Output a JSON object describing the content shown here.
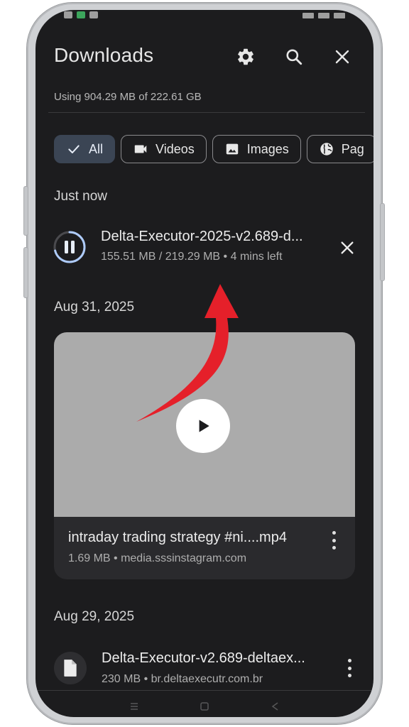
{
  "app": {
    "title": "Downloads",
    "storage_text": "Using 904.29 MB of 222.61 GB"
  },
  "toolbar": {
    "icons": [
      "gear-icon",
      "search-icon",
      "close-icon"
    ]
  },
  "filters": [
    {
      "label": "All",
      "icon": "check-icon",
      "selected": true
    },
    {
      "label": "Videos",
      "icon": "video-camera-icon",
      "selected": false
    },
    {
      "label": "Images",
      "icon": "image-icon",
      "selected": false
    },
    {
      "label": "Pag",
      "icon": "globe-icon",
      "selected": false
    }
  ],
  "sections": {
    "just_now": "Just now",
    "aug31": "Aug 31, 2025",
    "aug29": "Aug 29, 2025"
  },
  "active_download": {
    "name": "Delta-Executor-2025-v2.689-d...",
    "meta": "155.51 MB / 219.29 MB • 4 mins left",
    "progress": 0.71,
    "status": "paused-control",
    "icon": "pause-icon"
  },
  "video_item": {
    "title": "intraday trading strategy #ni....mp4",
    "meta": "1.69 MB • media.sssinstagram.com",
    "thumb_color": "#ababab"
  },
  "file_item": {
    "name": "Delta-Executor-v2.689-deltaex...",
    "meta": "230 MB • br.deltaexecutr.com.br",
    "icon": "document-icon"
  },
  "annotation": {
    "arrow_color": "#e5202a"
  },
  "colors": {
    "background": "#1c1c1e",
    "chip_selected": "#3b4554",
    "accent_ring": "#aecbfa"
  }
}
